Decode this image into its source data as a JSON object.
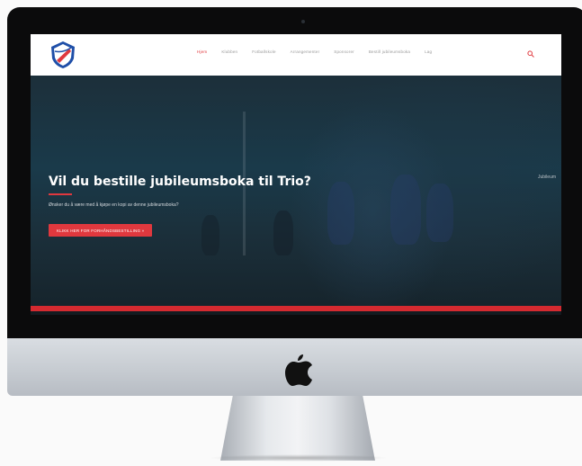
{
  "site": {
    "nav": {
      "items": [
        {
          "label": "Hjem",
          "active": true
        },
        {
          "label": "Klubben",
          "active": false
        },
        {
          "label": "Fotballskole",
          "active": false
        },
        {
          "label": "Arrangementer",
          "active": false
        },
        {
          "label": "Sponsorer",
          "active": false
        },
        {
          "label": "Bestill jubileumsboka",
          "active": false
        },
        {
          "label": "Lag",
          "active": false
        }
      ]
    },
    "hero": {
      "title": "Vil du bestille jubileumsboka til Trio?",
      "subtitle": "Ønsker du å være med å kjøpe en kopi av denne jubileumsboka?",
      "cta": "KLIKK HER FOR FORHÅNDSBESTILLING »",
      "side_note": "Jubileum"
    },
    "colors": {
      "accent": "#e0383e",
      "hero_bg": "#1b2f3a"
    }
  }
}
